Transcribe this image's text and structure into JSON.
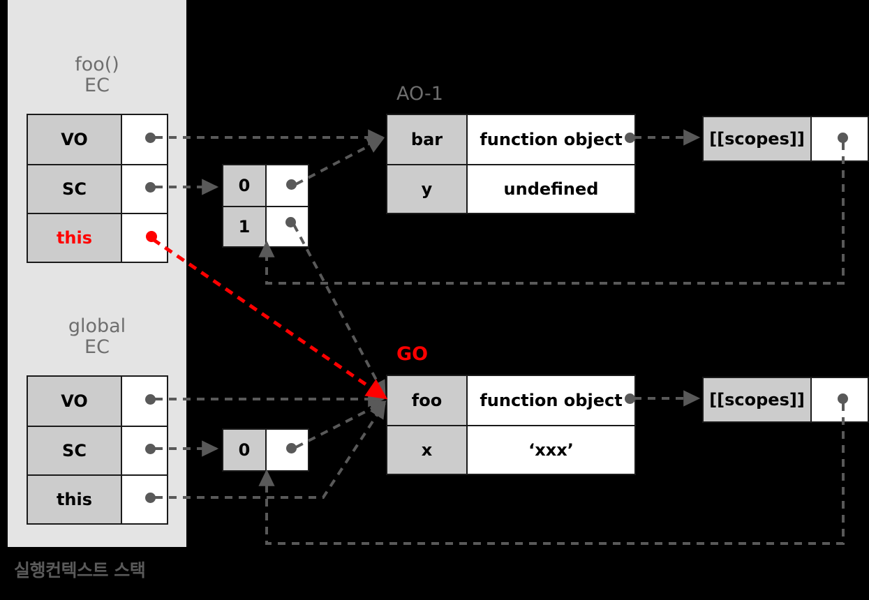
{
  "caption": "실행컨텍스트 스택",
  "colors": {
    "background": "#000000",
    "panel": "#e4e4e4",
    "key_cell": "#cccccc",
    "value_cell": "#ffffff",
    "border": "#1a1a1a",
    "wire": "#595959",
    "title": "#6e6e6e",
    "accent": "#ff0000"
  },
  "foo_ec": {
    "title_line1": "foo()",
    "title_line2": "EC",
    "rows": [
      {
        "key": "VO",
        "value": ""
      },
      {
        "key": "SC",
        "value": ""
      },
      {
        "key": "this",
        "value": ""
      }
    ]
  },
  "global_ec": {
    "title_line1": "global",
    "title_line2": "EC",
    "rows": [
      {
        "key": "VO",
        "value": ""
      },
      {
        "key": "SC",
        "value": ""
      },
      {
        "key": "this",
        "value": ""
      }
    ]
  },
  "foo_scope_chain": {
    "rows": [
      {
        "index": "0"
      },
      {
        "index": "1"
      }
    ]
  },
  "global_scope_chain": {
    "rows": [
      {
        "index": "0"
      }
    ]
  },
  "ao1": {
    "title": "AO-1",
    "rows": [
      {
        "key": "bar",
        "value": "function object"
      },
      {
        "key": "y",
        "value": "undefined"
      }
    ]
  },
  "go": {
    "title": "GO",
    "rows": [
      {
        "key": "foo",
        "value": "function object"
      },
      {
        "key": "x",
        "value": "‘xxx’"
      }
    ]
  },
  "scopes_top": {
    "label": "[[scopes]]"
  },
  "scopes_bottom": {
    "label": "[[scopes]]"
  }
}
